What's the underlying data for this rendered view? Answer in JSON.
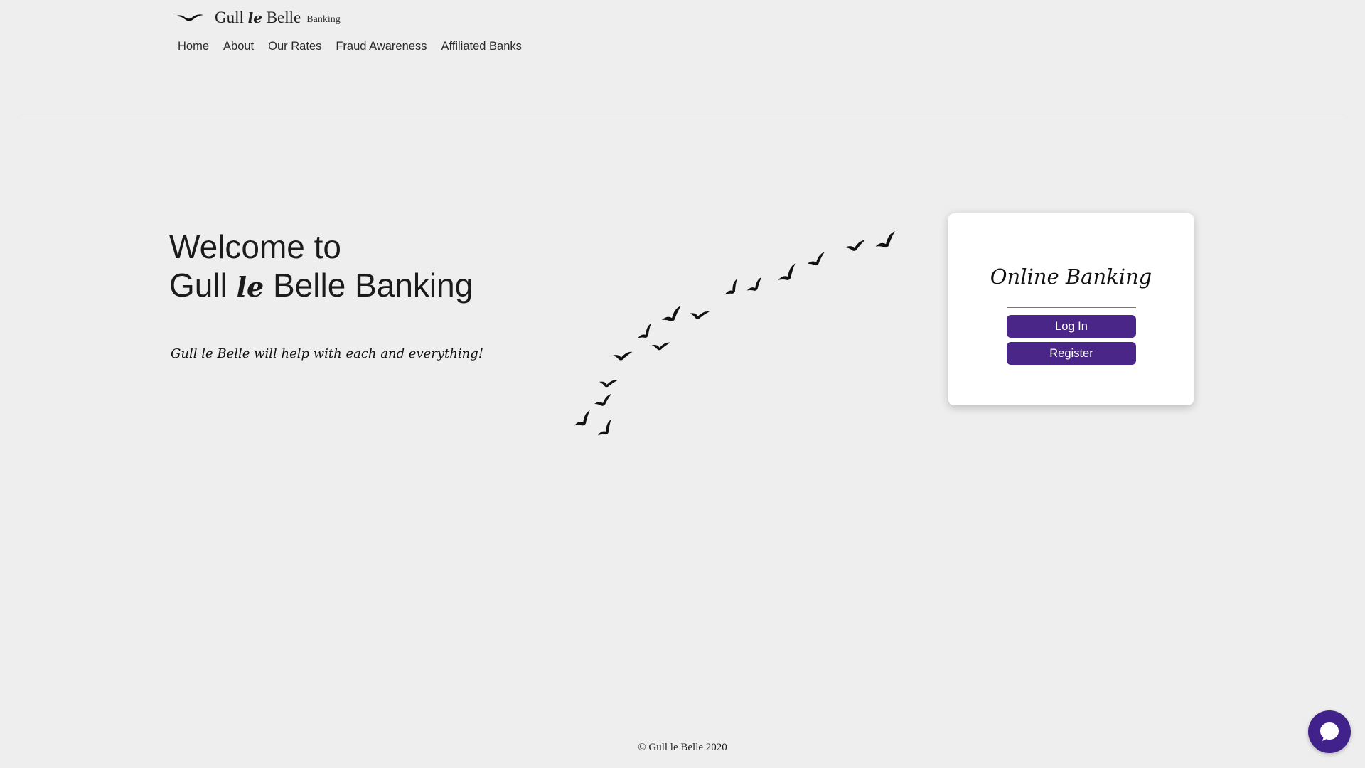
{
  "brand": {
    "name_part1": "Gull",
    "name_script": "le",
    "name_part2": "Belle",
    "name_small": "Banking",
    "logo_icon": "seagull-icon"
  },
  "nav": {
    "items": [
      "Home",
      "About",
      "Our Rates",
      "Fraud Awareness",
      "Affiliated Banks"
    ]
  },
  "hero": {
    "line1": "Welcome to",
    "line2_part1": "Gull",
    "line2_script": "le",
    "line2_part2": "Belle Banking",
    "tagline": "Gull le Belle will help with each and everything!",
    "illustration_icon": "flock-of-birds-icon"
  },
  "login_card": {
    "title": "Online Banking",
    "login_label": "Log In",
    "register_label": "Register"
  },
  "footer": {
    "copyright": "© Gull le Belle 2020"
  },
  "chat": {
    "icon": "chat-bubble-icon"
  },
  "colors": {
    "background": "#eeeeee",
    "accent": "#4a2688",
    "chat": "#41228a",
    "text": "#1c1c1c"
  }
}
